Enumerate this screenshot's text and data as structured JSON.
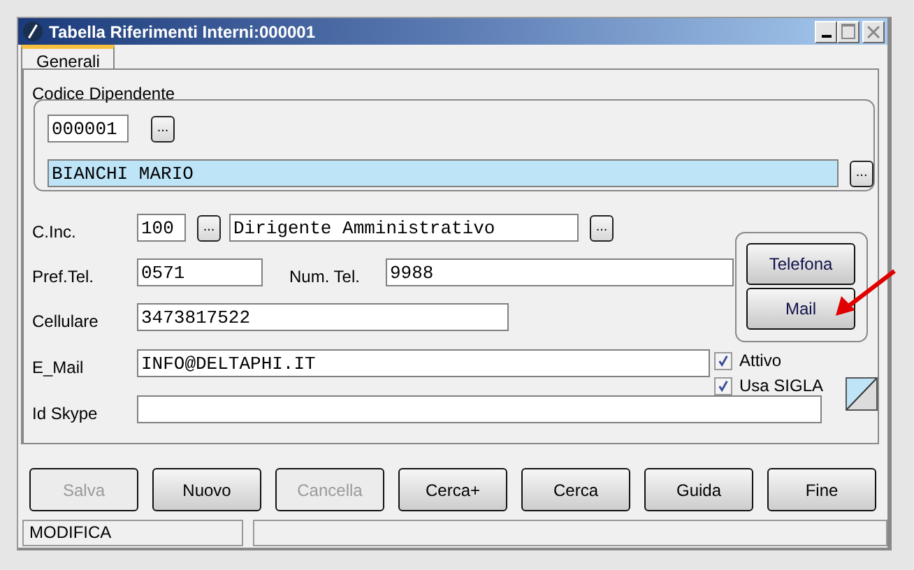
{
  "window": {
    "title": "Tabella Riferimenti Interni:000001"
  },
  "tabs": [
    {
      "label": "Generali",
      "selected": true
    }
  ],
  "employee": {
    "label": "Codice Dipendente",
    "code": "000001",
    "name": "BIANCHI MARIO",
    "lookup_buttons": [
      "...",
      "..."
    ]
  },
  "fields": [
    {
      "label": "C.Inc.",
      "value": "100",
      "lookup": "...",
      "description": "Dirigente Amministrativo",
      "description_lookup": "..."
    },
    {
      "label": "Pref.Tel.",
      "value": "0571",
      "second_label": "Num. Tel.",
      "second_value": "9988"
    },
    {
      "label": "Cellulare",
      "value": "3473817522"
    },
    {
      "label": "E_Mail",
      "value": "INFO@DELTAPHI.IT"
    },
    {
      "label": "Id Skype"
    }
  ],
  "contact_buttons": [
    "Telefona",
    "Mail"
  ],
  "checkboxes": [
    {
      "label": "Attivo",
      "checked": true
    },
    {
      "label": "Usa SIGLA",
      "checked": true
    }
  ],
  "buttons": [
    {
      "label": "Salva",
      "disabled": true
    },
    {
      "label": "Nuovo",
      "disabled": false
    },
    {
      "label": "Cancella",
      "disabled": true
    },
    {
      "label": "Cerca+",
      "disabled": false
    },
    {
      "label": "Cerca",
      "disabled": false
    },
    {
      "label": "Guida",
      "disabled": false
    },
    {
      "label": "Fine",
      "disabled": false
    }
  ],
  "status_bar": {
    "mode": "MODIFICA"
  }
}
